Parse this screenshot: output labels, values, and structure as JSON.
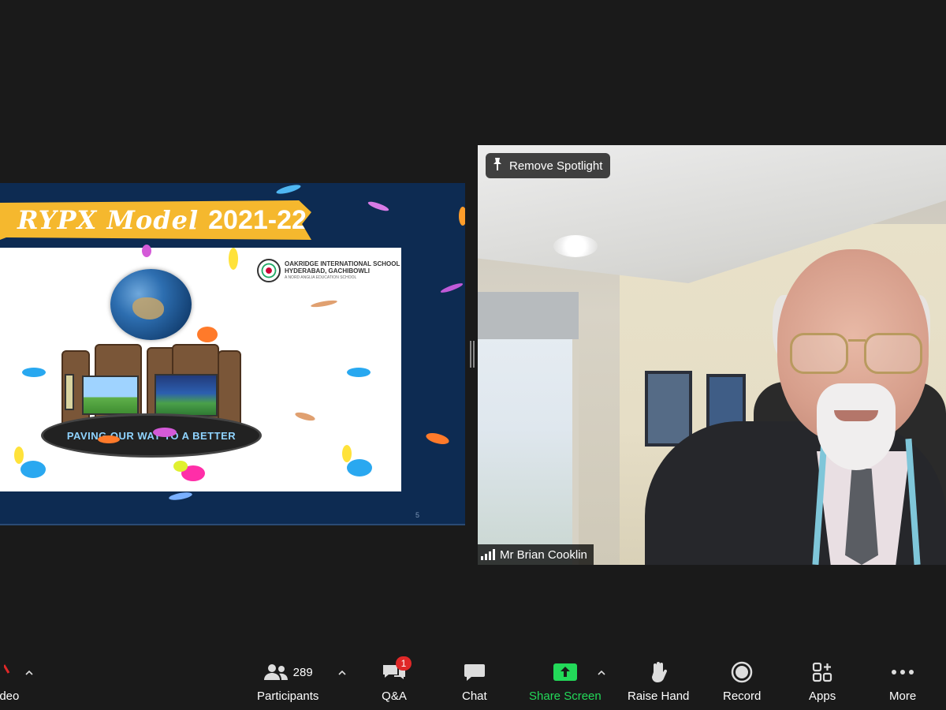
{
  "slide": {
    "title_script": "RYPX Model",
    "title_year": "2021-22",
    "school_line1": "OAKRIDGE INTERNATIONAL SCHOOL",
    "school_line2": "HYDERABAD, GACHIBOWLI",
    "school_line3": "A NORD ANGLIA EDUCATION SCHOOL",
    "base_text": "PAVING OUR WAY TO A BETTER",
    "page_number": "5"
  },
  "video": {
    "spotlight_label": "Remove Spotlight",
    "participant_name": "Mr Brian Cooklin"
  },
  "toolbar": {
    "video_label": "ideo",
    "participants_label": "Participants",
    "participants_count": "289",
    "qa_label": "Q&A",
    "qa_badge": "1",
    "chat_label": "Chat",
    "share_label": "Share Screen",
    "raise_label": "Raise Hand",
    "record_label": "Record",
    "apps_label": "Apps",
    "more_label": "More",
    "share_color": "#23d959"
  }
}
